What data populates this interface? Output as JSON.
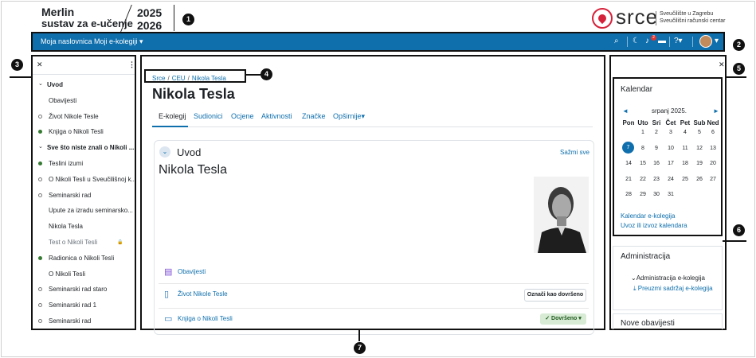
{
  "branding": {
    "title": "Merlin",
    "subtitle": "sustav za e-učenje",
    "year_top": "2025",
    "year_bottom": "2026",
    "org_logo_text": "srce",
    "org_line1": "Sveučilište u Zagrebu",
    "org_line2": "Sveučilišni računski centar"
  },
  "callouts": [
    "1",
    "2",
    "3",
    "4",
    "5",
    "6",
    "7"
  ],
  "navbar": {
    "home_label": "Moja naslovnica",
    "courses_label": "Moji e-kolegiji",
    "icons": [
      "search-icon",
      "dark-mode-icon",
      "bell-icon",
      "chat-icon",
      "help-icon",
      "avatar"
    ],
    "notification_count": "2",
    "bg_color": "#0f6fad"
  },
  "course_index": {
    "items": [
      {
        "label": "Uvod",
        "kind": "section"
      },
      {
        "label": "Obavijesti",
        "kind": "plain"
      },
      {
        "label": "Život Nikole Tesle",
        "kind": "empty"
      },
      {
        "label": "Knjiga o Nikoli Tesli",
        "kind": "done"
      },
      {
        "label": "Sve što niste znali o Nikoli ...",
        "kind": "section"
      },
      {
        "label": "Teslini izumi",
        "kind": "done"
      },
      {
        "label": "O Nikoli Tesli u Sveučilišnoj k...",
        "kind": "empty"
      },
      {
        "label": "Seminarski rad",
        "kind": "empty"
      },
      {
        "label": "Upute za izradu seminarsko...",
        "kind": "plain"
      },
      {
        "label": "Nikola Tesla",
        "kind": "plain"
      },
      {
        "label": "Test o Nikoli Tesli",
        "kind": "locked"
      },
      {
        "label": "Radionica o Nikoli Tesli",
        "kind": "done"
      },
      {
        "label": "O Nikoli Tesli",
        "kind": "plain"
      },
      {
        "label": "Seminarski rad staro",
        "kind": "empty"
      },
      {
        "label": "Seminarski rad 1",
        "kind": "empty"
      },
      {
        "label": "Seminarski rad",
        "kind": "empty"
      }
    ]
  },
  "breadcrumb": {
    "items": [
      "Srce",
      "CEU",
      "Nikola Tesla"
    ]
  },
  "page": {
    "title": "Nikola Tesla"
  },
  "tabs": [
    "E-kolegij",
    "Sudionici",
    "Ocjene",
    "Aktivnosti",
    "Značke",
    "Opširnije"
  ],
  "section": {
    "name": "Uvod",
    "collapse_all": "Sažmi sve",
    "heading": "Nikola Tesla",
    "activities": [
      {
        "label": "Obavijesti",
        "icon": "forum-icon"
      },
      {
        "label": "Život Nikole Tesle",
        "icon": "page-icon"
      },
      {
        "label": "Knjiga o Nikoli Tesli",
        "icon": "book-icon"
      }
    ],
    "mark_done_label": "Označi kao dovršeno",
    "done_label": "Dovršeno"
  },
  "calendar": {
    "title": "Kalendar",
    "month": "srpanj 2025.",
    "weekdays": [
      "Pon",
      "Uto",
      "Sri",
      "Čet",
      "Pet",
      "Sub",
      "Ned"
    ],
    "weeks": [
      [
        "",
        "1",
        "2",
        "3",
        "4",
        "5",
        "6"
      ],
      [
        "7",
        "8",
        "9",
        "10",
        "11",
        "12",
        "13"
      ],
      [
        "14",
        "15",
        "16",
        "17",
        "18",
        "19",
        "20"
      ],
      [
        "21",
        "22",
        "23",
        "24",
        "25",
        "26",
        "27"
      ],
      [
        "28",
        "29",
        "30",
        "31",
        "",
        "",
        ""
      ]
    ],
    "today": "7",
    "link_course": "Kalendar e-kolegija",
    "link_import": "Uvoz ili izvoz kalendara"
  },
  "admin": {
    "title": "Administracija",
    "course_admin": "Administracija e-kolegija",
    "download": "Preuzmi sadržaj e-kolegija"
  },
  "news": {
    "title": "Nove obavijesti"
  }
}
